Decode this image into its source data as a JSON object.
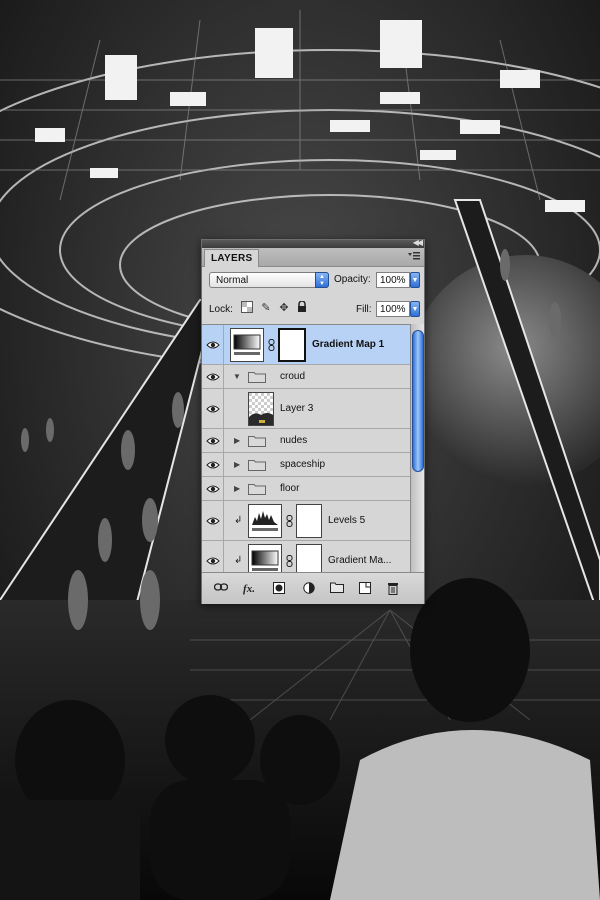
{
  "panel": {
    "tab_label": "LAYERS",
    "blend_mode": "Normal",
    "opacity_label": "Opacity:",
    "opacity_value": "100%",
    "lock_label": "Lock:",
    "fill_label": "Fill:",
    "fill_value": "100%"
  },
  "layers": [
    {
      "name": "Gradient Map 1",
      "kind": "adjustment-gradient",
      "selected": true,
      "visible": true
    },
    {
      "name": "croud",
      "kind": "group-expanded",
      "selected": false,
      "visible": true
    },
    {
      "name": "Layer 3",
      "kind": "pixel",
      "selected": false,
      "visible": true
    },
    {
      "name": "nudes",
      "kind": "group",
      "selected": false,
      "visible": true
    },
    {
      "name": "spaceship",
      "kind": "group",
      "selected": false,
      "visible": true
    },
    {
      "name": "floor",
      "kind": "group",
      "selected": false,
      "visible": true
    },
    {
      "name": "Levels 5",
      "kind": "adjustment-levels",
      "selected": false,
      "visible": true
    },
    {
      "name": "Gradient Ma...",
      "kind": "adjustment-gradient",
      "selected": false,
      "visible": true
    }
  ],
  "bottom_bar_icons": [
    "link-icon",
    "fx-icon",
    "mask-icon",
    "adjustment-icon",
    "folder-icon",
    "new-layer-icon",
    "trash-icon"
  ],
  "colors": {
    "panel_bg": "#d6d6d6",
    "selection": "#b7d2f4",
    "accent_blue": "#2f6fd6"
  }
}
